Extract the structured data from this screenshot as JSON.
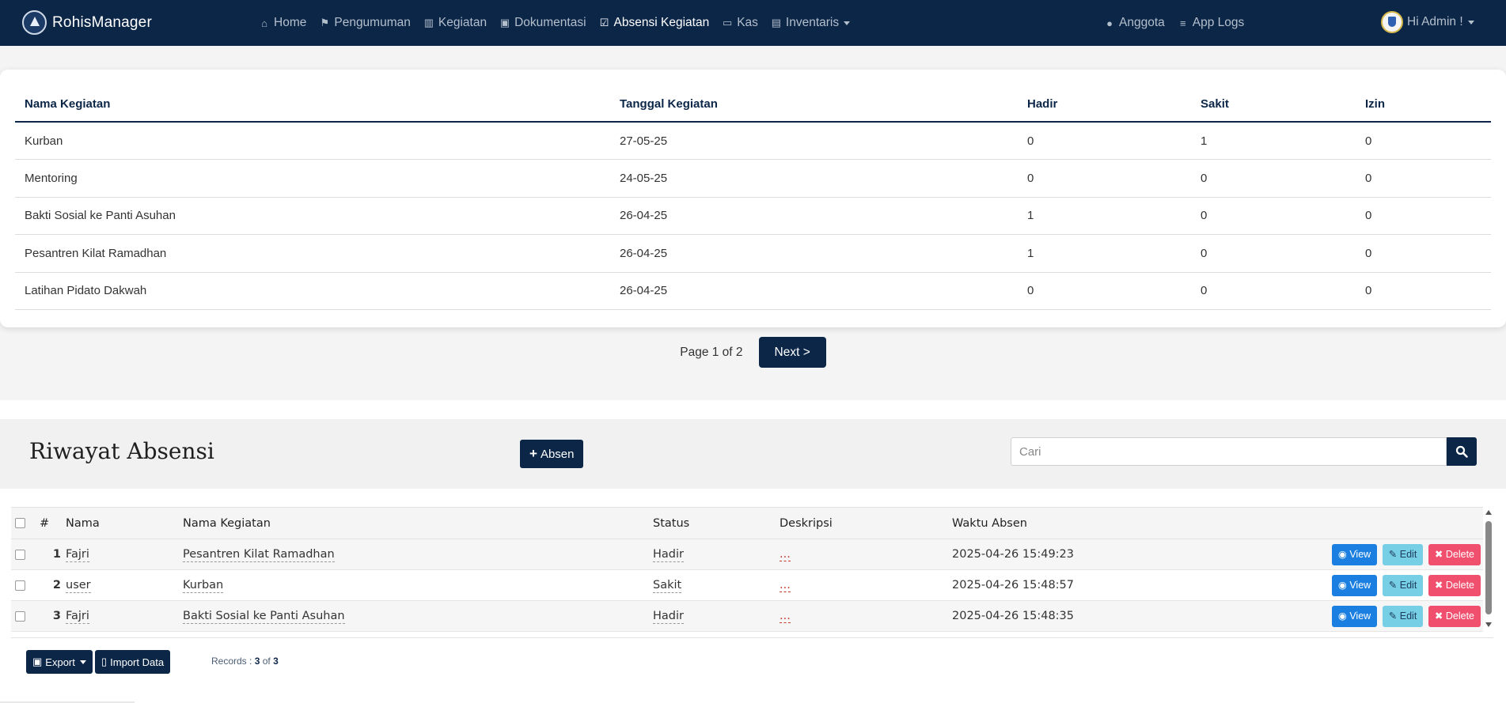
{
  "navbar": {
    "brand": "RohisManager",
    "items": [
      {
        "label": "Home",
        "icon": "home-icon",
        "glyph": "⌂"
      },
      {
        "label": "Pengumuman",
        "icon": "signpost-icon",
        "glyph": "⚑"
      },
      {
        "label": "Kegiatan",
        "icon": "map-icon",
        "glyph": "▥"
      },
      {
        "label": "Dokumentasi",
        "icon": "image-icon",
        "glyph": "▣"
      },
      {
        "label": "Absensi Kegiatan",
        "icon": "check-square-icon",
        "glyph": "☑"
      },
      {
        "label": "Kas",
        "icon": "money-icon",
        "glyph": "▭"
      },
      {
        "label": "Inventaris",
        "icon": "archive-icon",
        "glyph": "▤"
      }
    ],
    "right_items": [
      {
        "label": "Anggota",
        "icon": "user-icon",
        "glyph": "●"
      },
      {
        "label": "App Logs",
        "icon": "list-icon",
        "glyph": "≡"
      }
    ],
    "user_label": "Hi Admin !"
  },
  "summary": {
    "columns": [
      "Nama Kegiatan",
      "Tanggal Kegiatan",
      "Hadir",
      "Sakit",
      "Izin"
    ],
    "rows": [
      {
        "nama": "Kurban",
        "tanggal": "27-05-25",
        "hadir": "0",
        "sakit": "1",
        "izin": "0"
      },
      {
        "nama": "Mentoring",
        "tanggal": "24-05-25",
        "hadir": "0",
        "sakit": "0",
        "izin": "0"
      },
      {
        "nama": "Bakti Sosial ke Panti Asuhan",
        "tanggal": "26-04-25",
        "hadir": "1",
        "sakit": "0",
        "izin": "0"
      },
      {
        "nama": "Pesantren Kilat Ramadhan",
        "tanggal": "26-04-25",
        "hadir": "1",
        "sakit": "0",
        "izin": "0"
      },
      {
        "nama": "Latihan Pidato Dakwah",
        "tanggal": "26-04-25",
        "hadir": "0",
        "sakit": "0",
        "izin": "0"
      }
    ],
    "page_info": "Page 1 of 2",
    "next_label": "Next >"
  },
  "riwayat": {
    "title": "Riwayat Absensi",
    "add_label": "Absen",
    "search_placeholder": "Cari",
    "columns": {
      "num": "#",
      "nama": "Nama",
      "kegiatan": "Nama Kegiatan",
      "status": "Status",
      "deskripsi": "Deskripsi",
      "waktu": "Waktu Absen"
    },
    "rows": [
      {
        "num": "1",
        "nama": "Fajri",
        "kegiatan": "Pesantren Kilat Ramadhan",
        "status": "Hadir",
        "deskripsi": "...",
        "waktu": "2025-04-26 15:49:23"
      },
      {
        "num": "2",
        "nama": "user",
        "kegiatan": "Kurban",
        "status": "Sakit",
        "deskripsi": "...",
        "waktu": "2025-04-26 15:48:57"
      },
      {
        "num": "3",
        "nama": "Fajri",
        "kegiatan": "Bakti Sosial ke Panti Asuhan",
        "status": "Hadir",
        "deskripsi": "...",
        "waktu": "2025-04-26 15:48:35"
      }
    ],
    "actions": {
      "view": "View",
      "edit": "Edit",
      "delete": "Delete"
    },
    "export_label": "Export",
    "import_label": "Import Data",
    "records_prefix": "Records :",
    "records_shown": "3",
    "records_of": "of",
    "records_total": "3"
  },
  "colors": {
    "navy": "#0c2648",
    "view": "#1a7fe0",
    "edit": "#77cfe6",
    "delete": "#f0506e"
  }
}
